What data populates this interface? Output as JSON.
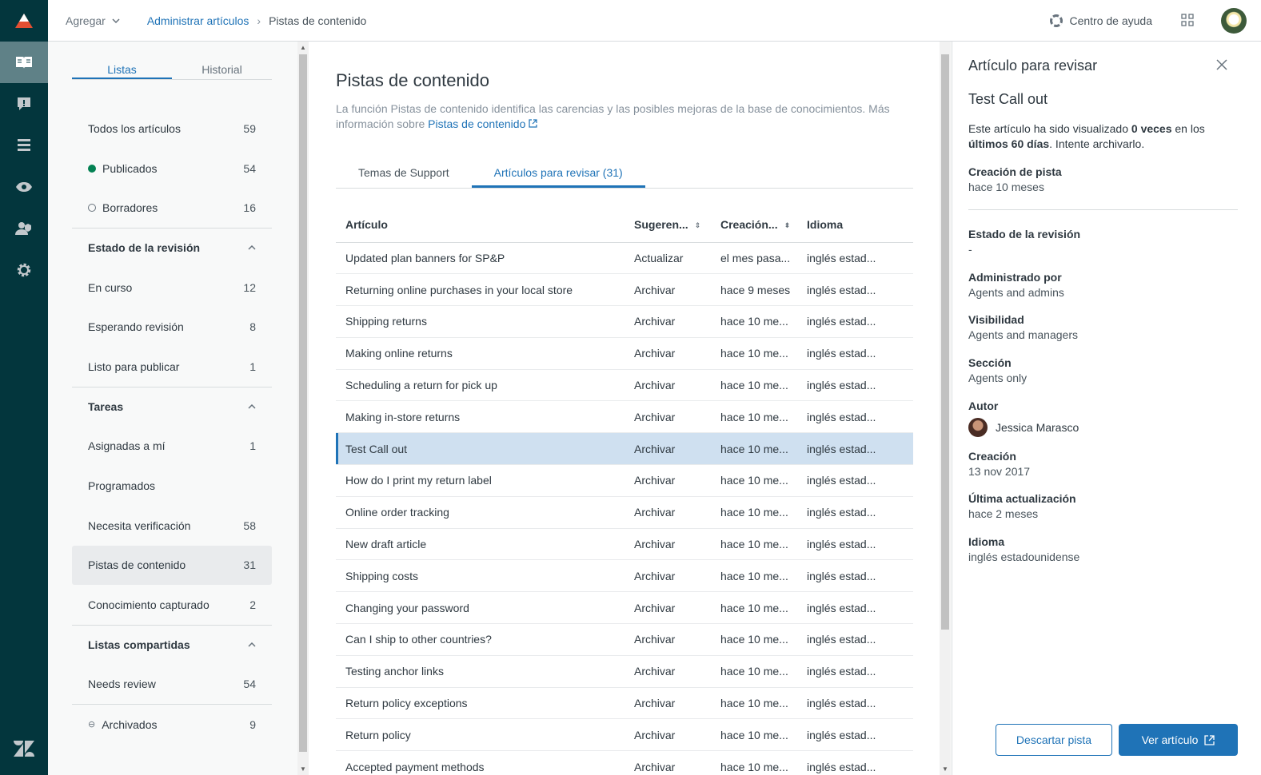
{
  "topbar": {
    "add_label": "Agregar",
    "breadcrumb_link": "Administrar artículos",
    "breadcrumb_current": "Pistas de contenido",
    "help_label": "Centro de ayuda"
  },
  "leftnav": {
    "tabs": [
      "Listas",
      "Historial"
    ],
    "all": {
      "label": "Todos los artículos",
      "count": "59"
    },
    "published": {
      "label": "Publicados",
      "count": "54"
    },
    "drafts": {
      "label": "Borradores",
      "count": "16"
    },
    "review_section": "Estado de la revisión",
    "review_items": [
      {
        "label": "En curso",
        "count": "12"
      },
      {
        "label": "Esperando revisión",
        "count": "8"
      },
      {
        "label": "Listo para publicar",
        "count": "1"
      }
    ],
    "tasks_section": "Tareas",
    "task_items": [
      {
        "label": "Asignadas a mí",
        "count": "1"
      },
      {
        "label": "Programados",
        "count": ""
      },
      {
        "label": "Necesita verificación",
        "count": "58"
      },
      {
        "label": "Pistas de contenido",
        "count": "31"
      },
      {
        "label": "Conocimiento capturado",
        "count": "2"
      }
    ],
    "shared_section": "Listas compartidas",
    "shared_items": [
      {
        "label": "Needs review",
        "count": "54"
      }
    ],
    "archived": {
      "label": "Archivados",
      "count": "9"
    }
  },
  "main": {
    "title": "Pistas de contenido",
    "description": "La función Pistas de contenido identifica las carencias y las posibles mejoras de la base de conocimientos. Más información sobre ",
    "description_link": "Pistas de contenido",
    "tabs": [
      "Temas de Support",
      "Artículos para revisar (31)"
    ],
    "columns": [
      "Artículo",
      "Sugeren...",
      "Creación...",
      "Idioma"
    ],
    "rows": [
      [
        "Updated plan banners for SP&P",
        "Actualizar",
        "el mes pasa...",
        "inglés estad..."
      ],
      [
        "Returning online purchases in your local store",
        "Archivar",
        "hace 9 meses",
        "inglés estad..."
      ],
      [
        "Shipping returns",
        "Archivar",
        "hace 10 me...",
        "inglés estad..."
      ],
      [
        "Making online returns",
        "Archivar",
        "hace 10 me...",
        "inglés estad..."
      ],
      [
        "Scheduling a return for pick up",
        "Archivar",
        "hace 10 me...",
        "inglés estad..."
      ],
      [
        "Making in-store returns",
        "Archivar",
        "hace 10 me...",
        "inglés estad..."
      ],
      [
        "Test Call out",
        "Archivar",
        "hace 10 me...",
        "inglés estad..."
      ],
      [
        "How do I print my return label",
        "Archivar",
        "hace 10 me...",
        "inglés estad..."
      ],
      [
        "Online order tracking",
        "Archivar",
        "hace 10 me...",
        "inglés estad..."
      ],
      [
        "New draft article",
        "Archivar",
        "hace 10 me...",
        "inglés estad..."
      ],
      [
        "Shipping costs",
        "Archivar",
        "hace 10 me...",
        "inglés estad..."
      ],
      [
        "Changing your password",
        "Archivar",
        "hace 10 me...",
        "inglés estad..."
      ],
      [
        "Can I ship to other countries?",
        "Archivar",
        "hace 10 me...",
        "inglés estad..."
      ],
      [
        "Testing anchor links",
        "Archivar",
        "hace 10 me...",
        "inglés estad..."
      ],
      [
        "Return policy exceptions",
        "Archivar",
        "hace 10 me...",
        "inglés estad..."
      ],
      [
        "Return policy",
        "Archivar",
        "hace 10 me...",
        "inglés estad..."
      ],
      [
        "Accepted payment methods",
        "Archivar",
        "hace 10 me...",
        "inglés estad..."
      ]
    ]
  },
  "panel": {
    "header": "Artículo para revisar",
    "article_title": "Test Call out",
    "msg_1": "Este artículo ha sido visualizado ",
    "msg_bold_1": "0 veces",
    "msg_2": " en los ",
    "msg_bold_2": "últimos 60 días",
    "msg_3": ". Intente archivarlo.",
    "hint_created_label": "Creación de pista",
    "hint_created_value": "hace 10 meses",
    "review_state_label": "Estado de la revisión",
    "review_state_value": "-",
    "managed_label": "Administrado por",
    "managed_value": "Agents and admins",
    "visibility_label": "Visibilidad",
    "visibility_value": "Agents and managers",
    "section_label": "Sección",
    "section_value": "Agents only",
    "author_label": "Autor",
    "author_value": "Jessica Marasco",
    "created_label": "Creación",
    "created_value": "13 nov 2017",
    "updated_label": "Última actualización",
    "updated_value": "hace 2 meses",
    "language_label": "Idioma",
    "language_value": "inglés estadounidense",
    "dismiss_label": "Descartar pista",
    "view_label": "Ver artículo"
  },
  "colors": {
    "rail": "#03363d",
    "accent": "#1f73b7",
    "published": "#038153",
    "selected_row": "#cfe0f0"
  }
}
